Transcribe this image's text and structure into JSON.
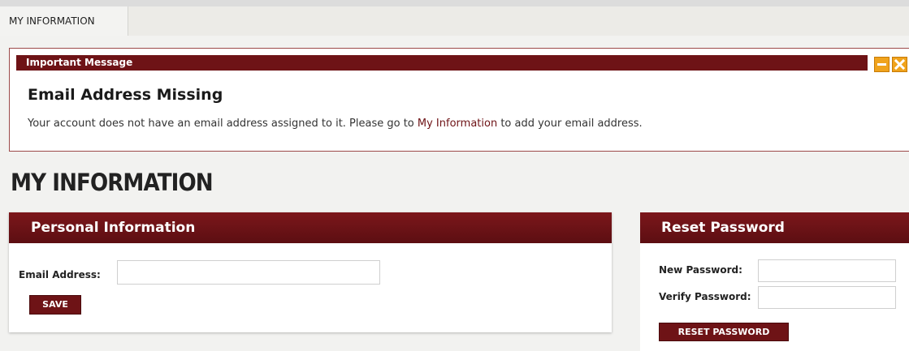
{
  "topnav": {
    "tab_label": "MY INFORMATION"
  },
  "message": {
    "header": "Important Message",
    "title": "Email Address Missing",
    "text_before": "Your account does not have an email address assigned to it. Please go to ",
    "link": "My Information",
    "text_after": " to add your email address.",
    "minimize_icon": "minimize-icon",
    "close_icon": "close-icon"
  },
  "page": {
    "title": "MY INFORMATION"
  },
  "personal": {
    "title": "Personal Information",
    "email_label": "Email Address:",
    "email_value": "",
    "save_label": "SAVE"
  },
  "reset": {
    "title": "Reset Password",
    "new_label": "New Password:",
    "verify_label": "Verify Password:",
    "button_label": "RESET PASSWORD"
  },
  "colors": {
    "brand": "#6e1316",
    "accent": "#f0a31c",
    "background": "#f2f2f0"
  }
}
